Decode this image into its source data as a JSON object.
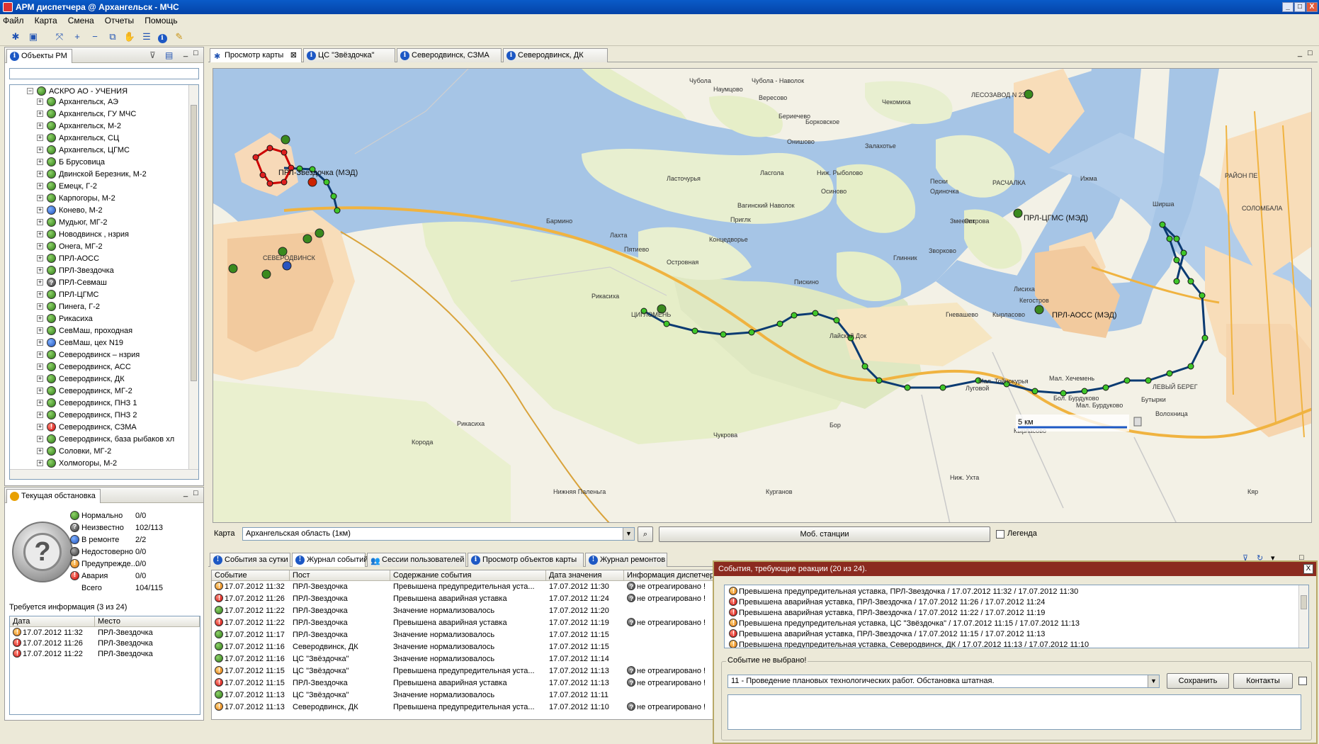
{
  "window": {
    "title": "АРМ диспетчера @ Архангельск - МЧС",
    "min": "_",
    "max": "□",
    "close": "X"
  },
  "menu": [
    "Файл",
    "Карта",
    "Смена",
    "Отчеты",
    "Помощь"
  ],
  "objects_panel": {
    "tab": "Объекты РМ",
    "search_placeholder": "",
    "tree_root": "АСКРО АО - УЧЕНИЯ",
    "items": [
      {
        "label": "Архангельск,  АЭ",
        "status": "green"
      },
      {
        "label": "Архангельск, ГУ МЧС",
        "status": "green"
      },
      {
        "label": "Архангельск, М-2",
        "status": "green"
      },
      {
        "label": "Архангельск, СЦ",
        "status": "green"
      },
      {
        "label": "Архангельск, ЦГМС",
        "status": "green"
      },
      {
        "label": "Б Брусовица",
        "status": "green"
      },
      {
        "label": "Двинской Березник, М-2",
        "status": "green"
      },
      {
        "label": "Емецк, Г-2",
        "status": "green"
      },
      {
        "label": "Карпогоры, М-2",
        "status": "green"
      },
      {
        "label": "Конево, М-2",
        "status": "blue"
      },
      {
        "label": "Мудьюг, МГ-2",
        "status": "green"
      },
      {
        "label": "Новодвинск , нзрия",
        "status": "green"
      },
      {
        "label": "Онега, МГ-2",
        "status": "green"
      },
      {
        "label": "ПРЛ-АОСС",
        "status": "green"
      },
      {
        "label": "ПРЛ-Звездочка",
        "status": "green"
      },
      {
        "label": "ПРЛ-Севмаш",
        "status": "gray"
      },
      {
        "label": "ПРЛ-ЦГМС",
        "status": "green"
      },
      {
        "label": "Пинега, Г-2",
        "status": "green"
      },
      {
        "label": "Рикасиха",
        "status": "green"
      },
      {
        "label": "СевМаш, проходная",
        "status": "green"
      },
      {
        "label": "СевМаш, цех N19",
        "status": "blue"
      },
      {
        "label": "Северодвинск – нзрия",
        "status": "green"
      },
      {
        "label": "Северодвинск, АСС",
        "status": "green"
      },
      {
        "label": "Северодвинск, ДК",
        "status": "green"
      },
      {
        "label": "Северодвинск, МГ-2",
        "status": "green"
      },
      {
        "label": "Северодвинск, ПНЗ 1",
        "status": "green"
      },
      {
        "label": "Северодвинск, ПНЗ 2",
        "status": "green"
      },
      {
        "label": "Северодвинск, СЗМА",
        "status": "red"
      },
      {
        "label": "Северодвинск, база рыбаков  хл",
        "status": "green"
      },
      {
        "label": "Соловки, МГ-2",
        "status": "green"
      },
      {
        "label": "Холмогоры, М-2",
        "status": "green"
      }
    ]
  },
  "situation_panel": {
    "tab": "Текущая обстановка",
    "stats": [
      {
        "label": "Нормально",
        "value": "0/0",
        "status": "green"
      },
      {
        "label": "Неизвестно",
        "value": "102/113",
        "status": "gray"
      },
      {
        "label": "В ремонте",
        "value": "2/2",
        "status": "blue"
      },
      {
        "label": "Недостоверно",
        "value": "0/0",
        "status": "black"
      },
      {
        "label": "Предупрежде...",
        "value": "0/0",
        "status": "orange"
      },
      {
        "label": "Авария",
        "value": "0/0",
        "status": "red"
      },
      {
        "label": "Всего",
        "value": "104/115",
        "status": "none"
      }
    ],
    "required_info": "Требуется информация (3 из 24)",
    "cols": [
      "Дата",
      "Место"
    ],
    "rows": [
      {
        "date": "17.07.2012 11:32",
        "place": "ПРЛ-Звездочка",
        "status": "orange"
      },
      {
        "date": "17.07.2012 11:26",
        "place": "ПРЛ-Звездочка",
        "status": "red"
      },
      {
        "date": "17.07.2012 11:22",
        "place": "ПРЛ-Звездочка",
        "status": "red"
      }
    ]
  },
  "map_tabs": [
    "Просмотр карты",
    "ЦС \"Звёздочка\"",
    "Северодвинск, СЗМА",
    "Северодвинск, ДК"
  ],
  "map": {
    "scale": "5 км",
    "stations": [
      "ПРЛ-Звездочка (МЭД)",
      "ПРЛ-ЦГМС (МЭД)",
      "ПРЛ-АОСС (МЭД)"
    ],
    "places": [
      "Чубола",
      "Наумцово",
      "Чубола - Наволок",
      "Вересово",
      "Бериечево",
      "Борковское",
      "Чекомиха",
      "ЛЕСОЗАВОД N 23",
      "Онишово",
      "Залахотье",
      "Ласточурья",
      "Ласгола",
      "Ниж. Рыболово",
      "Осиново",
      "Пески",
      "Одиночка",
      "Ижма",
      "РАСЧАЛКА",
      "РАЙОН ПЕ",
      "СОЛОМБАЛА",
      "Ширша",
      "Вагинский Наволок",
      "Приглк",
      "Концедворье",
      "Бармино",
      "Лахта",
      "Пятиево",
      "Островная",
      "Острова",
      "Змеевик",
      "Зворково",
      "Глинник",
      "Пискино",
      "Кегостров",
      "Гневашево",
      "Кырласово",
      "Лисиха",
      "Рикасиха",
      "ЦИГЛОМЕНЬ",
      "Лайский Док",
      "СЕВЕРОДВИНСК",
      "Корода",
      "Чукрова",
      "Бор",
      "Мал. Тойнокурья",
      "Луговой",
      "Мал. Хечемень",
      "Бол. Бурдуково",
      "Мал. Бурдуково",
      "Бутырки",
      "ЛЕВЫЙ БЕРЕГ",
      "Волохница",
      "Кырласово",
      "Рикасиха",
      "Нижняя Паленьга",
      "Курганов",
      "Ниж. Ухта",
      "Кяр"
    ]
  },
  "map_controls": {
    "label": "Карта",
    "select_value": "Архангельская область (1км)",
    "mobile_button": "Моб. станции",
    "legend": "Легенда"
  },
  "bottom_tabs": [
    "События за сутки",
    "Журнал событий",
    "Сессии пользователей",
    "Просмотр объектов карты",
    "Журнал ремонтов"
  ],
  "events_table": {
    "cols": [
      "Событие",
      "Пост",
      "Содержание события",
      "Дата значения",
      "Информация диспетчер"
    ],
    "rows": [
      {
        "time": "17.07.2012 11:32",
        "post": "ПРЛ-Звездочка",
        "content": "Превышена предупредительная уста...",
        "date": "17.07.2012 11:30",
        "info": "не отреагировано !",
        "status": "orange",
        "q": true
      },
      {
        "time": "17.07.2012 11:26",
        "post": "ПРЛ-Звездочка",
        "content": "Превышена аварийная уставка",
        "date": "17.07.2012 11:24",
        "info": "не отреагировано !",
        "status": "red",
        "q": true
      },
      {
        "time": "17.07.2012 11:22",
        "post": "ПРЛ-Звездочка",
        "content": "Значение нормализовалось",
        "date": "17.07.2012 11:20",
        "info": "",
        "status": "green",
        "q": false
      },
      {
        "time": "17.07.2012 11:22",
        "post": "ПРЛ-Звездочка",
        "content": "Превышена аварийная уставка",
        "date": "17.07.2012 11:19",
        "info": "не отреагировано !",
        "status": "red",
        "q": true
      },
      {
        "time": "17.07.2012 11:17",
        "post": "ПРЛ-Звездочка",
        "content": "Значение нормализовалось",
        "date": "17.07.2012 11:15",
        "info": "",
        "status": "green",
        "q": false
      },
      {
        "time": "17.07.2012 11:16",
        "post": "Северодвинск, ДК",
        "content": "Значение нормализовалось",
        "date": "17.07.2012 11:15",
        "info": "",
        "status": "green",
        "q": false
      },
      {
        "time": "17.07.2012 11:16",
        "post": "ЦС \"Звёздочка\"",
        "content": "Значение нормализовалось",
        "date": "17.07.2012 11:14",
        "info": "",
        "status": "green",
        "q": false
      },
      {
        "time": "17.07.2012 11:15",
        "post": "ЦС \"Звёздочка\"",
        "content": "Превышена предупредительная уста...",
        "date": "17.07.2012 11:13",
        "info": "не отреагировано !",
        "status": "orange",
        "q": true
      },
      {
        "time": "17.07.2012 11:15",
        "post": "ПРЛ-Звездочка",
        "content": "Превышена аварийная уставка",
        "date": "17.07.2012 11:13",
        "info": "не отреагировано !",
        "status": "red",
        "q": true
      },
      {
        "time": "17.07.2012 11:13",
        "post": "ЦС \"Звёздочка\"",
        "content": "Значение нормализовалось",
        "date": "17.07.2012 11:11",
        "info": "",
        "status": "green",
        "q": false
      },
      {
        "time": "17.07.2012 11:13",
        "post": "Северодвинск, ДК",
        "content": "Превышена предупредительная уста...",
        "date": "17.07.2012 11:10",
        "info": "не отреагировано !",
        "status": "orange",
        "q": true
      }
    ]
  },
  "popup": {
    "title": "События, требующие реакции (20 из 24).",
    "close": "X",
    "events": [
      {
        "text": "Превышена предупредительная уставка, ПРЛ-Звездочка / 17.07.2012 11:32 / 17.07.2012 11:30",
        "status": "orange"
      },
      {
        "text": "Превышена аварийная уставка, ПРЛ-Звездочка / 17.07.2012 11:26 / 17.07.2012 11:24",
        "status": "red"
      },
      {
        "text": "Превышена аварийная уставка, ПРЛ-Звездочка / 17.07.2012 11:22 / 17.07.2012 11:19",
        "status": "red"
      },
      {
        "text": "Превышена предупредительная уставка, ЦС \"Звёздочка\" / 17.07.2012 11:15 / 17.07.2012 11:13",
        "status": "orange"
      },
      {
        "text": "Превышена аварийная уставка, ПРЛ-Звездочка / 17.07.2012 11:15 / 17.07.2012 11:13",
        "status": "red"
      },
      {
        "text": "Превышена предупредительная уставка, Северодвинск, ДК / 17.07.2012 11:13 / 17.07.2012 11:10",
        "status": "orange"
      }
    ],
    "group_title": "Событие не выбрано!",
    "select_value": "11 - Проведение плановых технологических работ. Обстановка штатная.",
    "save": "Сохранить",
    "contacts": "Контакты"
  }
}
